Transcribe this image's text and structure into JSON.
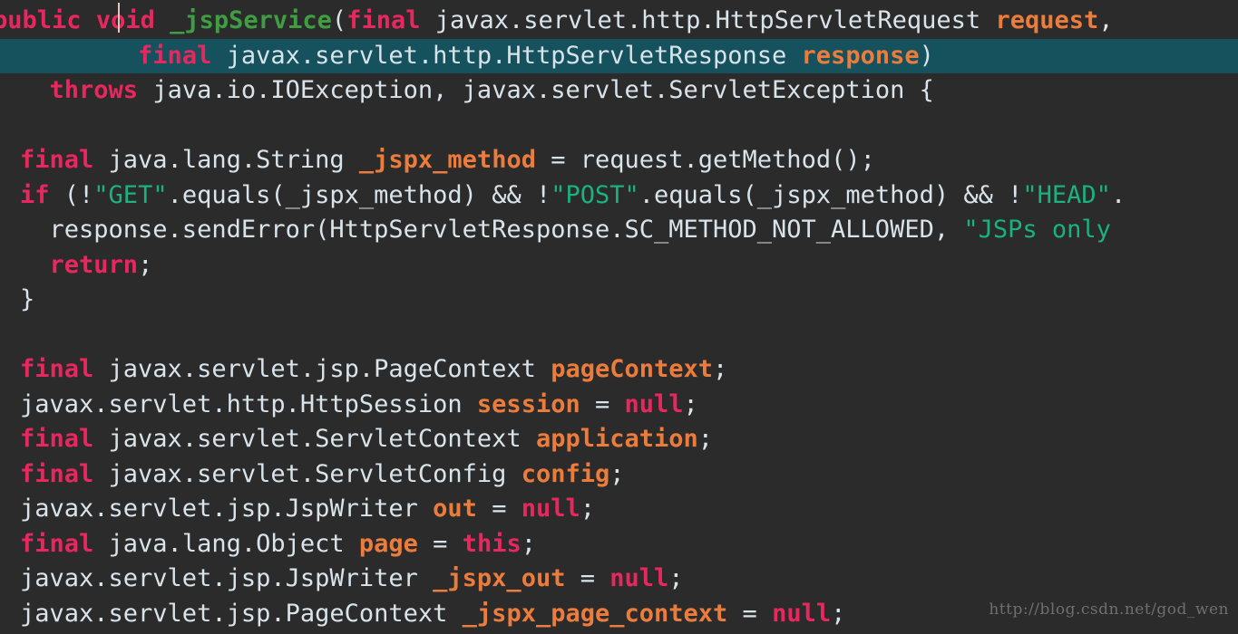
{
  "editor": {
    "language": "java",
    "background_color": "#2b2b2b",
    "current_line_highlight_color": "#16525d",
    "caret_color": "#e0c9b8",
    "default_text_color": "#d8e3ea",
    "token_colors": {
      "keyword": "#e8275f",
      "method": "#3f9d42",
      "variable": "#ec7c3c",
      "string": "#18b37e",
      "identifier": "#d8e3ea"
    }
  },
  "watermark": {
    "text": "http://blog.csdn.net/god_wen"
  },
  "code": {
    "lines": [
      {
        "id": 1,
        "current": false,
        "clipped_left": true,
        "tokens": [
          {
            "t": "public",
            "c": "kw"
          },
          {
            "t": " ",
            "c": "punc"
          },
          {
            "t": "void",
            "c": "kw"
          },
          {
            "t": " ",
            "c": "punc"
          },
          {
            "t": "_jspService",
            "c": "method"
          },
          {
            "t": "(",
            "c": "punc"
          },
          {
            "t": "final",
            "c": "kw"
          },
          {
            "t": " javax.servlet.http.HttpServletRequest ",
            "c": "ident"
          },
          {
            "t": "request",
            "c": "var"
          },
          {
            "t": ",",
            "c": "punc"
          }
        ]
      },
      {
        "id": 2,
        "current": true,
        "clipped_left": false,
        "tokens": [
          {
            "t": "        ",
            "c": "punc"
          },
          {
            "t": "final",
            "c": "kw"
          },
          {
            "t": " javax.servlet.http.HttpServletResponse ",
            "c": "ident"
          },
          {
            "t": "response",
            "c": "var"
          },
          {
            "t": ")",
            "c": "punc"
          }
        ]
      },
      {
        "id": 3,
        "current": false,
        "clipped_left": false,
        "tokens": [
          {
            "t": "  ",
            "c": "punc"
          },
          {
            "t": "throws",
            "c": "kw"
          },
          {
            "t": " java.io.IOException, javax.servlet.ServletException {",
            "c": "ident"
          }
        ]
      },
      {
        "id": 4,
        "current": false,
        "clipped_left": false,
        "tokens": [
          {
            "t": "",
            "c": "punc"
          }
        ]
      },
      {
        "id": 5,
        "current": false,
        "clipped_left": false,
        "tokens": [
          {
            "t": "final",
            "c": "kw"
          },
          {
            "t": " java.lang.String ",
            "c": "ident"
          },
          {
            "t": "_jspx_method",
            "c": "var"
          },
          {
            "t": " = request.getMethod();",
            "c": "ident"
          }
        ]
      },
      {
        "id": 6,
        "current": false,
        "clipped_left": false,
        "tokens": [
          {
            "t": "if",
            "c": "kw"
          },
          {
            "t": " (!",
            "c": "ident"
          },
          {
            "t": "\"GET\"",
            "c": "str"
          },
          {
            "t": ".equals(_jspx_method) && !",
            "c": "ident"
          },
          {
            "t": "\"POST\"",
            "c": "str"
          },
          {
            "t": ".equals(_jspx_method) && !",
            "c": "ident"
          },
          {
            "t": "\"HEAD\"",
            "c": "str"
          },
          {
            "t": ".",
            "c": "ident"
          }
        ]
      },
      {
        "id": 7,
        "current": false,
        "clipped_left": false,
        "tokens": [
          {
            "t": "  response.sendError(HttpServletResponse.SC_METHOD_NOT_ALLOWED, ",
            "c": "ident"
          },
          {
            "t": "\"JSPs only ",
            "c": "str"
          }
        ]
      },
      {
        "id": 8,
        "current": false,
        "clipped_left": false,
        "tokens": [
          {
            "t": "  ",
            "c": "punc"
          },
          {
            "t": "return",
            "c": "kw"
          },
          {
            "t": ";",
            "c": "ident"
          }
        ]
      },
      {
        "id": 9,
        "current": false,
        "clipped_left": false,
        "tokens": [
          {
            "t": "}",
            "c": "ident"
          }
        ]
      },
      {
        "id": 10,
        "current": false,
        "clipped_left": false,
        "tokens": [
          {
            "t": "",
            "c": "punc"
          }
        ]
      },
      {
        "id": 11,
        "current": false,
        "clipped_left": false,
        "tokens": [
          {
            "t": "final",
            "c": "kw"
          },
          {
            "t": " javax.servlet.jsp.PageContext ",
            "c": "ident"
          },
          {
            "t": "pageContext",
            "c": "var"
          },
          {
            "t": ";",
            "c": "ident"
          }
        ]
      },
      {
        "id": 12,
        "current": false,
        "clipped_left": false,
        "tokens": [
          {
            "t": "javax.servlet.http.HttpSession ",
            "c": "ident"
          },
          {
            "t": "session",
            "c": "var"
          },
          {
            "t": " = ",
            "c": "ident"
          },
          {
            "t": "null",
            "c": "nul"
          },
          {
            "t": ";",
            "c": "ident"
          }
        ]
      },
      {
        "id": 13,
        "current": false,
        "clipped_left": false,
        "tokens": [
          {
            "t": "final",
            "c": "kw"
          },
          {
            "t": " javax.servlet.ServletContext ",
            "c": "ident"
          },
          {
            "t": "application",
            "c": "var"
          },
          {
            "t": ";",
            "c": "ident"
          }
        ]
      },
      {
        "id": 14,
        "current": false,
        "clipped_left": false,
        "tokens": [
          {
            "t": "final",
            "c": "kw"
          },
          {
            "t": " javax.servlet.ServletConfig ",
            "c": "ident"
          },
          {
            "t": "config",
            "c": "var"
          },
          {
            "t": ";",
            "c": "ident"
          }
        ]
      },
      {
        "id": 15,
        "current": false,
        "clipped_left": false,
        "tokens": [
          {
            "t": "javax.servlet.jsp.JspWriter ",
            "c": "ident"
          },
          {
            "t": "out",
            "c": "var"
          },
          {
            "t": " = ",
            "c": "ident"
          },
          {
            "t": "null",
            "c": "nul"
          },
          {
            "t": ";",
            "c": "ident"
          }
        ]
      },
      {
        "id": 16,
        "current": false,
        "clipped_left": false,
        "tokens": [
          {
            "t": "final",
            "c": "kw"
          },
          {
            "t": " java.lang.Object ",
            "c": "ident"
          },
          {
            "t": "page",
            "c": "var"
          },
          {
            "t": " = ",
            "c": "ident"
          },
          {
            "t": "this",
            "c": "kw"
          },
          {
            "t": ";",
            "c": "ident"
          }
        ]
      },
      {
        "id": 17,
        "current": false,
        "clipped_left": false,
        "tokens": [
          {
            "t": "javax.servlet.jsp.JspWriter ",
            "c": "ident"
          },
          {
            "t": "_jspx_out",
            "c": "var"
          },
          {
            "t": " = ",
            "c": "ident"
          },
          {
            "t": "null",
            "c": "nul"
          },
          {
            "t": ";",
            "c": "ident"
          }
        ]
      },
      {
        "id": 18,
        "current": false,
        "clipped_left": false,
        "tokens": [
          {
            "t": "javax.servlet.jsp.PageContext ",
            "c": "ident"
          },
          {
            "t": "_jspx_page_context",
            "c": "var"
          },
          {
            "t": " = ",
            "c": "ident"
          },
          {
            "t": "null",
            "c": "nul"
          },
          {
            "t": ";",
            "c": "ident"
          }
        ]
      }
    ]
  }
}
